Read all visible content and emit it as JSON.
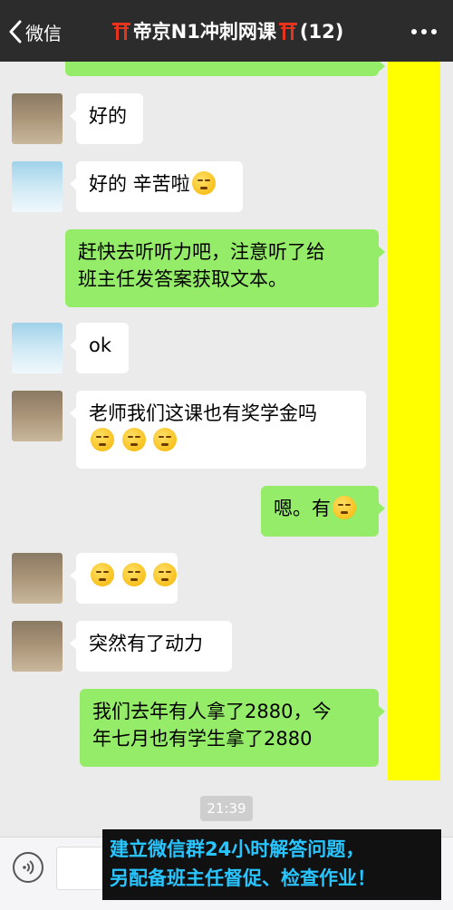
{
  "header": {
    "back_label": "微信",
    "title": "帝京N1冲刺网课",
    "member_count": "(12)"
  },
  "messages": [
    {
      "side": "in",
      "avatar": "person",
      "text": "好的"
    },
    {
      "side": "in",
      "avatar": "sky",
      "text": "好的 辛苦啦",
      "emoji_count": 1
    },
    {
      "side": "out",
      "lines": [
        "赶快去听听力吧，注意听了给",
        "班主任发答案获取文本。"
      ]
    },
    {
      "side": "in",
      "avatar": "sky",
      "text": "ok"
    },
    {
      "side": "in",
      "avatar": "person",
      "lines": [
        "老师我们这课也有奖学金吗"
      ],
      "emoji_count": 3
    },
    {
      "side": "out",
      "text": "嗯。有",
      "emoji_count": 1
    },
    {
      "side": "in",
      "avatar": "person",
      "text": "",
      "emoji_count": 3
    },
    {
      "side": "in",
      "avatar": "person",
      "text": "突然有了动力"
    },
    {
      "side": "out",
      "lines": [
        "我们去年有人拿了2880，今",
        "年七月也有学生拿了2880"
      ]
    }
  ],
  "timestamp": "21:39",
  "banner": {
    "line1": "建立微信群24小时解答问题，",
    "line2": "另配备班主任督促、检查作业！"
  },
  "colors": {
    "header_bg": "#2c2c2c",
    "chat_bg": "#ebebeb",
    "outgoing_bubble": "#95ec69",
    "incoming_bubble": "#ffffff",
    "highlight_overlay": "#ffff00",
    "banner_text": "#29c5ff"
  }
}
